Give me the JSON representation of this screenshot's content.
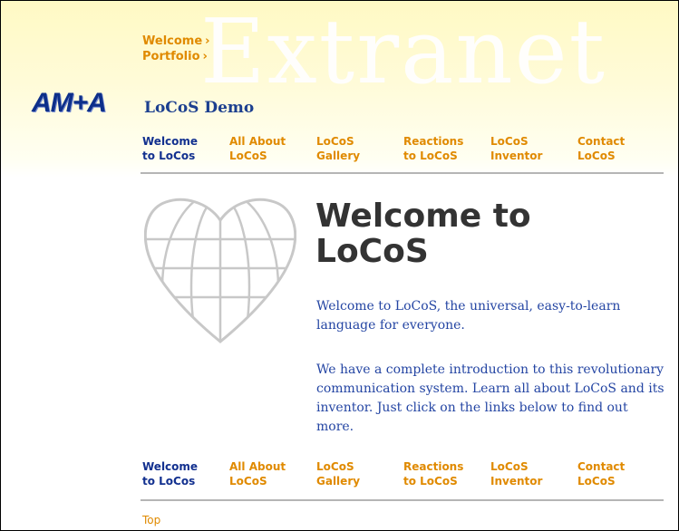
{
  "watermark": "Extranet",
  "breadcrumb": [
    {
      "label": "Welcome",
      "arrow": "›"
    },
    {
      "label": "Portfolio",
      "arrow": "›"
    }
  ],
  "logo": "AM+A",
  "site_title": "LoCoS Demo",
  "nav": [
    {
      "line1": "Welcome",
      "line2": "to LoCos",
      "active": true
    },
    {
      "line1": "All About",
      "line2": "LoCoS",
      "active": false
    },
    {
      "line1": "LoCoS",
      "line2": "Gallery",
      "active": false
    },
    {
      "line1": "Reactions",
      "line2": "to LoCoS",
      "active": false
    },
    {
      "line1": "LoCoS",
      "line2": "Inventor",
      "active": false
    },
    {
      "line1": "Contact",
      "line2": "LoCoS",
      "active": false
    }
  ],
  "main": {
    "heading": "Welcome to LoCoS",
    "paragraph1": "Welcome to LoCoS, the universal, easy-to-learn language for everyone.",
    "paragraph2": "We have a complete introduction to this revolutionary communication system. Learn all about LoCoS and its inventor. Just click on the links below to find out more."
  },
  "footer": {
    "top_link": "Top"
  },
  "colors": {
    "nav_link": "#e08a00",
    "nav_active": "#12308f",
    "body_text": "#2445a3",
    "heading": "#333333"
  },
  "icons": {
    "heart_globe": "heart-globe-icon"
  }
}
